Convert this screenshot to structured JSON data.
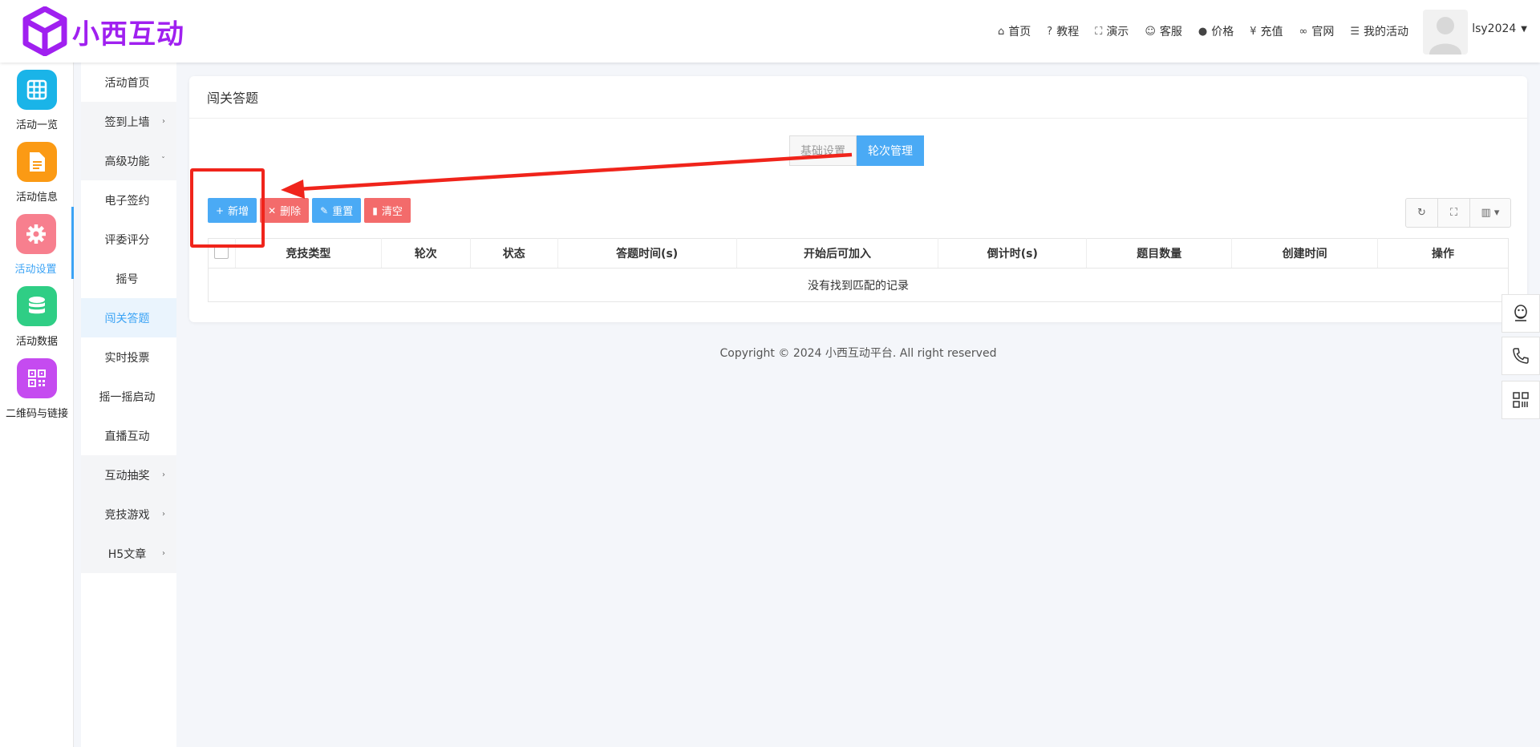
{
  "brand": {
    "name": "小西互动",
    "color": "#a020f0"
  },
  "topnav": [
    {
      "icon": "home-icon",
      "label": "首页"
    },
    {
      "icon": "help-circle-icon",
      "label": "教程"
    },
    {
      "icon": "expand-icon",
      "label": "演示"
    },
    {
      "icon": "smile-icon",
      "label": "客服"
    },
    {
      "icon": "info-icon",
      "label": "价格"
    },
    {
      "icon": "yen-icon",
      "label": "充值"
    },
    {
      "icon": "link-icon",
      "label": "官网"
    },
    {
      "icon": "list-icon",
      "label": "我的活动"
    }
  ],
  "user": {
    "name": "lsy2024"
  },
  "rail": [
    {
      "label": "活动一览",
      "icon": "grid-icon",
      "color": "#1ab4e8"
    },
    {
      "label": "活动信息",
      "icon": "document-icon",
      "color": "#fb9a14"
    },
    {
      "label": "活动设置",
      "icon": "gear-icon",
      "color": "#f77f8e"
    },
    {
      "label": "活动数据",
      "icon": "database-icon",
      "color": "#2fce85"
    },
    {
      "label": "二维码与链接",
      "icon": "qrcode-icon",
      "color": "#c54bf0"
    }
  ],
  "submenu": [
    {
      "label": "活动首页"
    },
    {
      "label": "签到上墙"
    },
    {
      "label": "高级功能"
    },
    {
      "label": "电子签约"
    },
    {
      "label": "评委评分"
    },
    {
      "label": "摇号"
    },
    {
      "label": "闯关答题"
    },
    {
      "label": "实时投票"
    },
    {
      "label": "摇一摇启动"
    },
    {
      "label": "直播互动"
    },
    {
      "label": "互动抽奖"
    },
    {
      "label": "竞技游戏"
    },
    {
      "label": "H5文章"
    }
  ],
  "page": {
    "title": "闯关答题",
    "tabs": [
      "基础设置",
      "轮次管理"
    ],
    "toolbar": {
      "add": "新增",
      "delete": "删除",
      "reset": "重置",
      "clear": "清空"
    },
    "columns": [
      "竞技类型",
      "轮次",
      "状态",
      "答题时间(s)",
      "开始后可加入",
      "倒计时(s)",
      "题目数量",
      "创建时间",
      "操作"
    ],
    "empty_text": "没有找到匹配的记录"
  },
  "copyright": "Copyright © 2024 小西互动平台. All right reserved",
  "colors": {
    "accent": "#4aaaf5",
    "danger": "#f36b6b",
    "annotation": "#f0241b"
  }
}
